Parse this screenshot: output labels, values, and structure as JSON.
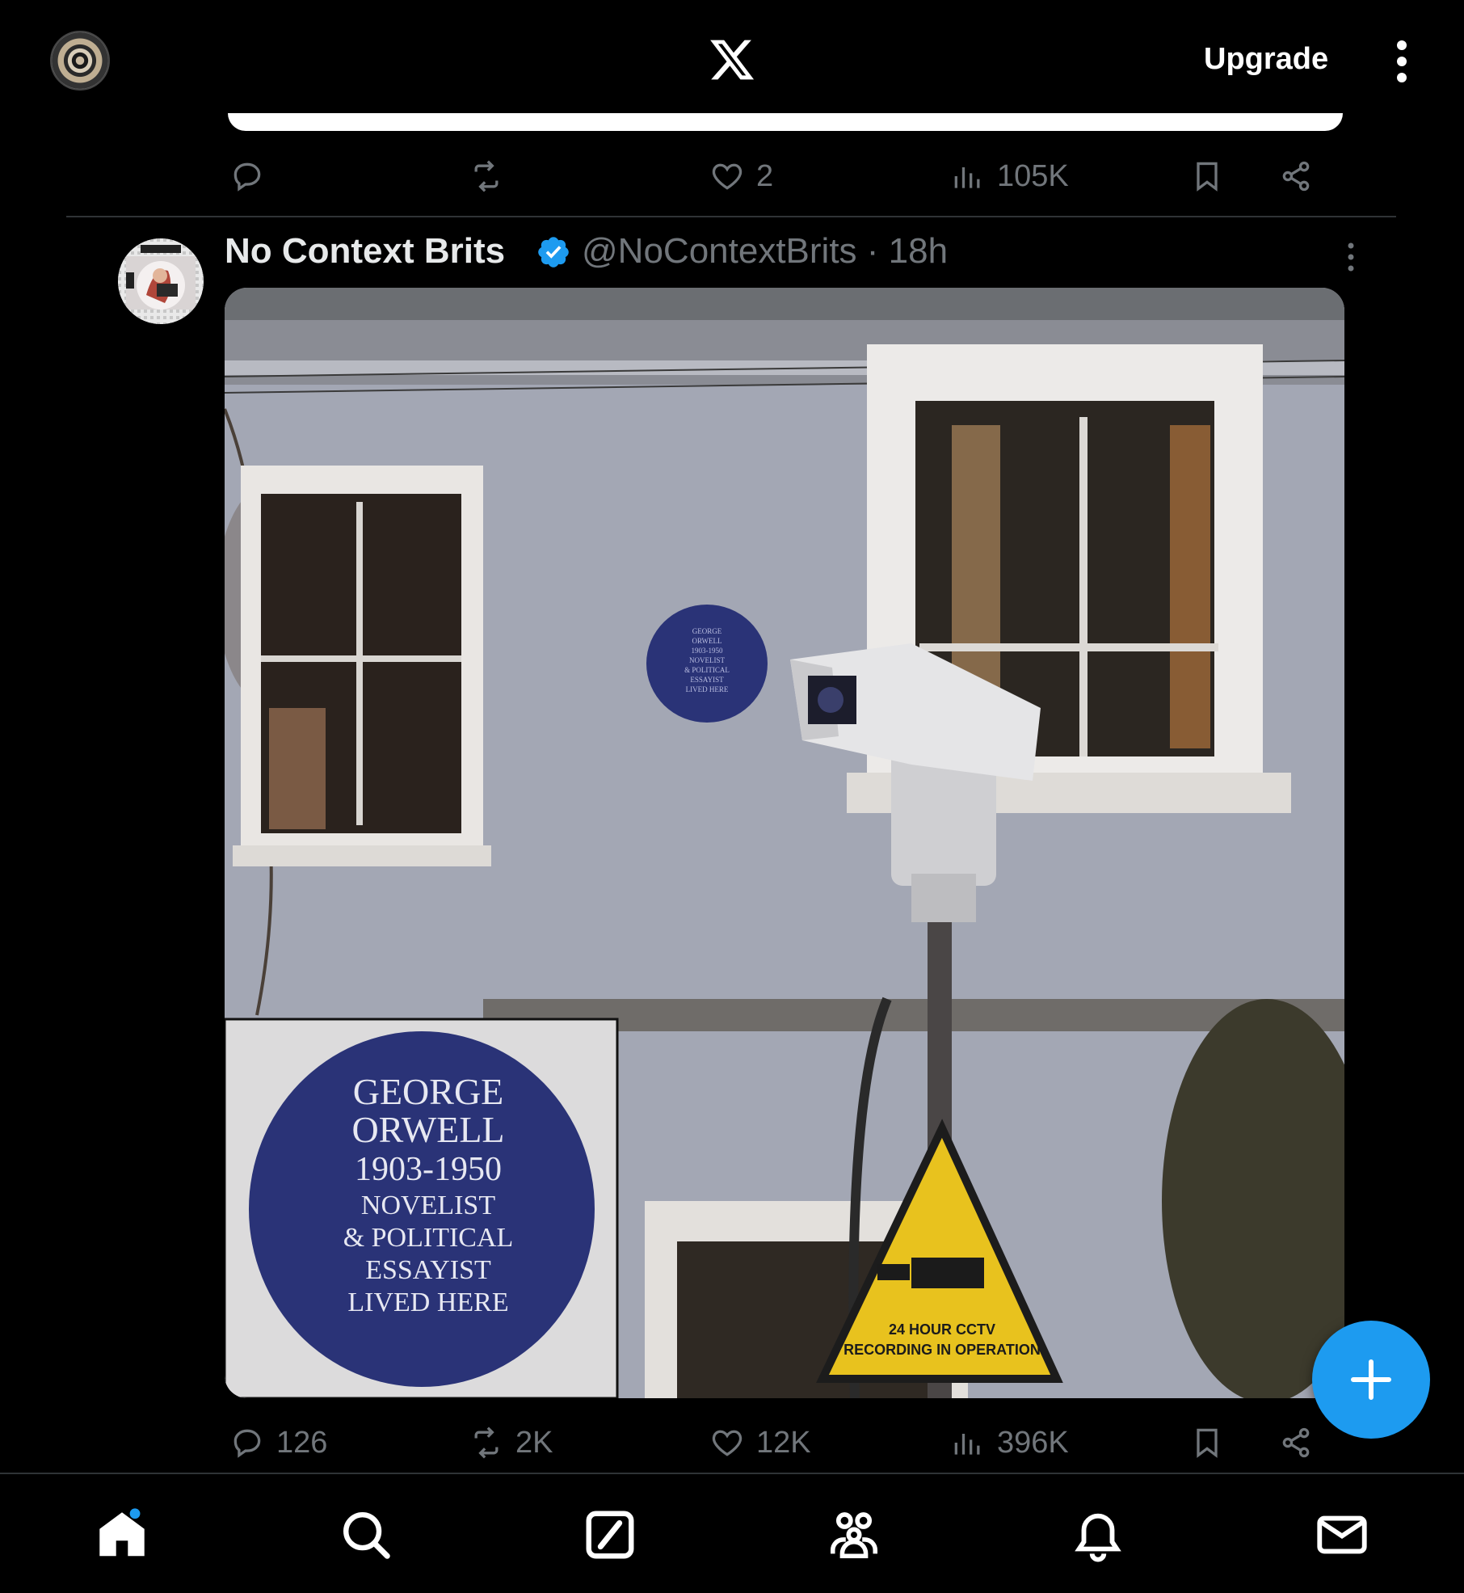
{
  "topbar": {
    "upgrade_label": "Upgrade"
  },
  "previous_tweet": {
    "actions": {
      "replies": "",
      "reposts": "",
      "likes": "2",
      "views": "105K"
    }
  },
  "tweet": {
    "author_name": "No Context Brits",
    "handle_and_time": "@NoContextBrits · 18h",
    "media": {
      "plaque_small_lines": [
        "GEORGE",
        "ORWELL",
        "1903-1950",
        "NOVELIST",
        "& POLITICAL",
        "ESSAYIST",
        "LIVED HERE"
      ],
      "plaque_inset_lines": [
        "GEORGE",
        "ORWELL",
        "1903-1950",
        "NOVELIST",
        "& POLITICAL",
        "ESSAYIST",
        "LIVED HERE"
      ],
      "sign_lines": [
        "24 HOUR CCTV",
        "RECORDING IN OPERATION"
      ]
    },
    "actions": {
      "replies": "126",
      "reposts": "2K",
      "likes": "12K",
      "views": "396K"
    }
  },
  "colors": {
    "accent": "#1d9bf0",
    "muted": "#71767b",
    "text": "#e7e9ea",
    "plaque": "#2a3377"
  },
  "bottom_nav": [
    "home-icon",
    "search-icon",
    "grok-icon",
    "communities-icon",
    "notifications-icon",
    "messages-icon"
  ]
}
